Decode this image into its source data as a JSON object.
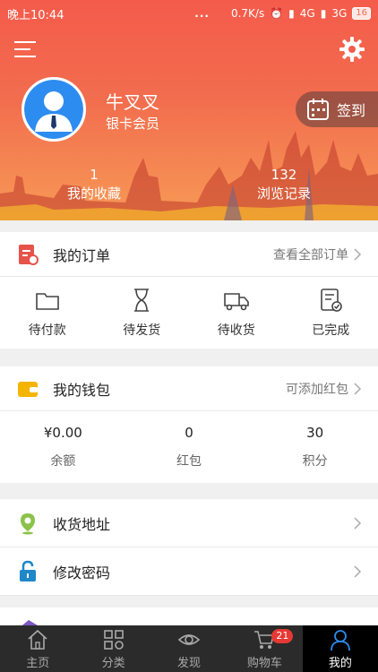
{
  "status_bar": {
    "time": "晚上10:44",
    "dots": "...",
    "speed": "0.7K/s",
    "net1": "4G",
    "net2": "3G",
    "battery": "16"
  },
  "profile": {
    "name": "牛叉叉",
    "level": "银卡会员",
    "signin_label": "签到",
    "favorites_count": "1",
    "favorites_label": "我的收藏",
    "history_count": "132",
    "history_label": "浏览记录"
  },
  "orders": {
    "title": "我的订单",
    "view_all": "查看全部订单",
    "items": [
      {
        "label": "待付款",
        "icon": "folder-icon"
      },
      {
        "label": "待发货",
        "icon": "hourglass-icon"
      },
      {
        "label": "待收货",
        "icon": "truck-icon"
      },
      {
        "label": "已完成",
        "icon": "checklist-icon"
      }
    ]
  },
  "wallet": {
    "title": "我的钱包",
    "add_redpacket": "可添加红包",
    "balance_value": "¥0.00",
    "balance_label": "余额",
    "redpacket_value": "0",
    "redpacket_label": "红包",
    "points_value": "30",
    "points_label": "积分"
  },
  "settings_list": [
    {
      "label": "收货地址",
      "icon": "location-pin-icon",
      "color": "#8bc34a"
    },
    {
      "label": "修改密码",
      "icon": "lock-icon",
      "color": "#1e88c8"
    }
  ],
  "tabbar": {
    "items": [
      {
        "label": "主页",
        "icon": "home-icon"
      },
      {
        "label": "分类",
        "icon": "category-icon"
      },
      {
        "label": "发现",
        "icon": "eye-icon"
      },
      {
        "label": "购物车",
        "icon": "cart-icon",
        "badge": "21"
      },
      {
        "label": "我的",
        "icon": "user-icon"
      }
    ],
    "active_index": 4
  },
  "colors": {
    "header_start": "#f45b4b",
    "header_end": "#f79a56",
    "badge": "#e53935",
    "tabbar_bg": "#2b2b2b"
  }
}
